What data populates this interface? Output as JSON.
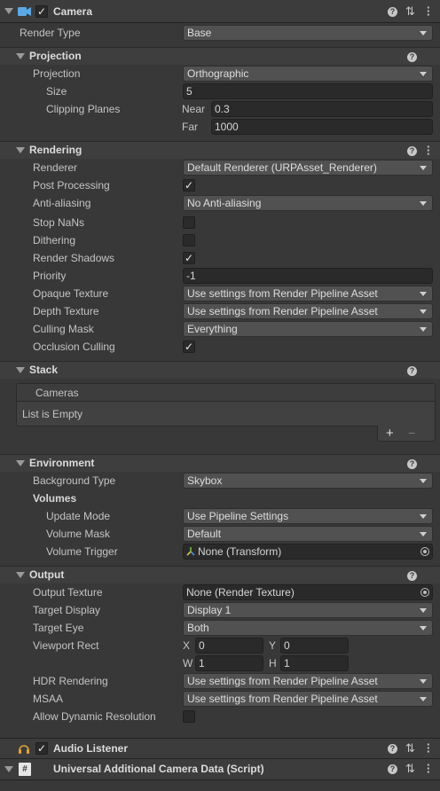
{
  "camera": {
    "title": "Camera",
    "enabled": "✓",
    "help": "?"
  },
  "render_type": {
    "label": "Render Type",
    "value": "Base"
  },
  "projection_section": {
    "title": "Projection"
  },
  "projection": {
    "label": "Projection",
    "value": "Orthographic",
    "size_label": "Size",
    "size_value": "5",
    "clipping_label": "Clipping Planes",
    "near_label": "Near",
    "near_value": "0.3",
    "far_label": "Far",
    "far_value": "1000"
  },
  "rendering_section": {
    "title": "Rendering"
  },
  "rendering": {
    "renderer_label": "Renderer",
    "renderer_value": "Default Renderer (URPAsset_Renderer)",
    "post_label": "Post Processing",
    "post_checked": "✓",
    "aa_label": "Anti-aliasing",
    "aa_value": "No Anti-aliasing",
    "nan_label": "Stop NaNs",
    "dither_label": "Dithering",
    "shadows_label": "Render Shadows",
    "shadows_checked": "✓",
    "priority_label": "Priority",
    "priority_value": "-1",
    "opaque_label": "Opaque Texture",
    "opaque_value": "Use settings from Render Pipeline Asset",
    "depth_label": "Depth Texture",
    "depth_value": "Use settings from Render Pipeline Asset",
    "culling_label": "Culling Mask",
    "culling_value": "Everything",
    "occlusion_label": "Occlusion Culling",
    "occlusion_checked": "✓"
  },
  "stack_section": {
    "title": "Stack"
  },
  "stack": {
    "header": "Cameras",
    "empty": "List is Empty",
    "add": "+",
    "remove": "−"
  },
  "environment_section": {
    "title": "Environment"
  },
  "environment": {
    "bg_label": "Background Type",
    "bg_value": "Skybox",
    "volumes_label": "Volumes",
    "update_label": "Update Mode",
    "update_value": "Use Pipeline Settings",
    "mask_label": "Volume Mask",
    "mask_value": "Default",
    "trigger_label": "Volume Trigger",
    "trigger_value": "None (Transform)"
  },
  "output_section": {
    "title": "Output"
  },
  "output": {
    "texture_label": "Output Texture",
    "texture_value": "None (Render Texture)",
    "display_label": "Target Display",
    "display_value": "Display 1",
    "eye_label": "Target Eye",
    "eye_value": "Both",
    "viewport_label": "Viewport Rect",
    "x_label": "X",
    "x_value": "0",
    "y_label": "Y",
    "y_value": "0",
    "w_label": "W",
    "w_value": "1",
    "h_label": "H",
    "h_value": "1",
    "hdr_label": "HDR Rendering",
    "hdr_value": "Use settings from Render Pipeline Asset",
    "msaa_label": "MSAA",
    "msaa_value": "Use settings from Render Pipeline Asset",
    "dynres_label": "Allow Dynamic Resolution"
  },
  "audio_listener": {
    "title": "Audio Listener",
    "enabled": "✓"
  },
  "additional_data": {
    "title": "Universal Additional Camera Data (Script)",
    "icon_glyph": "#"
  }
}
